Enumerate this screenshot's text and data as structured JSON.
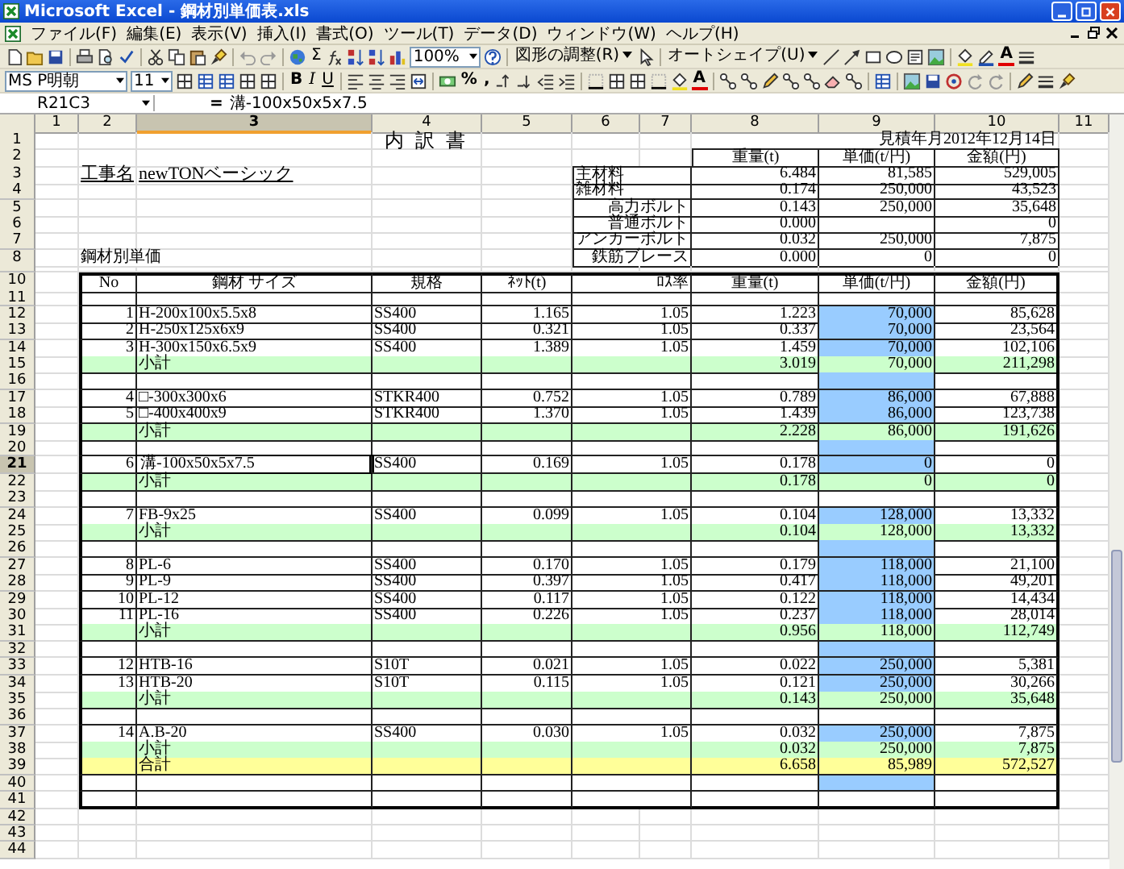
{
  "window": {
    "title": "Microsoft Excel - 鋼材別単価表.xls"
  },
  "menu": [
    "ファイル(F)",
    "編集(E)",
    "表示(V)",
    "挿入(I)",
    "書式(O)",
    "ツール(T)",
    "データ(D)",
    "ウィンドウ(W)",
    "ヘルプ(H)"
  ],
  "standard_toolbar": {
    "sum": "Σ",
    "zoom": "100%",
    "draw_menu": "図形の調整(R)",
    "autoshape_menu": "オートシェイプ(U)",
    "font_color": "A"
  },
  "format_toolbar": {
    "font": "MS P明朝",
    "size": "11",
    "bold": "B",
    "italic": "I",
    "underline": "U",
    "percent": "%",
    "comma": ",",
    "font_color": "A"
  },
  "formula_bar": {
    "name_box": "R21C3",
    "equals": "=",
    "formula": "溝-100x50x5x7.5"
  },
  "columns": [
    {
      "label": "1",
      "selected": false
    },
    {
      "label": "2",
      "selected": false
    },
    {
      "label": "3",
      "selected": true
    },
    {
      "label": "4",
      "selected": false
    },
    {
      "label": "5",
      "selected": false
    },
    {
      "label": "6",
      "selected": false
    },
    {
      "label": "7",
      "selected": false
    },
    {
      "label": "8",
      "selected": false
    },
    {
      "label": "9",
      "selected": false
    },
    {
      "label": "10",
      "selected": false
    },
    {
      "label": "11",
      "selected": false
    }
  ],
  "rows": [
    {
      "number": "1",
      "selected": false,
      "kind": "title",
      "title": "内 訳 書",
      "date": "見積年月2012年12月14日"
    },
    {
      "number": "2",
      "selected": false,
      "kind": "summary_head",
      "weight": "重量(t)",
      "unit_price": "単価(t/円)",
      "amount": "金額(円)"
    },
    {
      "number": "3",
      "selected": false,
      "kind": "main_summary",
      "project_label": "工事名",
      "project_name": "newTONベーシック",
      "label": "主材料",
      "weight": "6.484",
      "unit_price": "81,585",
      "amount": "529,005"
    },
    {
      "number": "4",
      "selected": false,
      "kind": "main_summary",
      "label": "雑材料",
      "weight": "0.174",
      "unit_price": "250,000",
      "amount": "43,523"
    },
    {
      "number": "5",
      "selected": false,
      "kind": "sub_summary",
      "label": "高力ボルト",
      "weight": "0.143",
      "unit_price": "250,000",
      "amount": "35,648"
    },
    {
      "number": "6",
      "selected": false,
      "kind": "sub_summary",
      "label": "普通ボルト",
      "weight": "0.000",
      "amount": "0"
    },
    {
      "number": "7",
      "selected": false,
      "kind": "sub_summary",
      "label": "アンカーボルト",
      "weight": "0.032",
      "unit_price": "250,000",
      "amount": "7,875"
    },
    {
      "number": "8",
      "selected": false,
      "kind": "sub_summary",
      "section_label": "鋼材別単価",
      "label": "鉄筋ブレース",
      "weight": "0.000",
      "unit_price": "0",
      "amount": "0"
    },
    {
      "kind": "collapsed"
    },
    {
      "number": "10",
      "selected": false,
      "kind": "table_head",
      "no": "No",
      "size": "鋼材 サイズ",
      "grade": "規格",
      "net": "ﾈｯﾄ(t)",
      "loss": "ﾛｽ率",
      "weight": "重量(t)",
      "unit_price": "単価(t/円)",
      "amount": "金額(円)"
    },
    {
      "number": "11",
      "selected": false,
      "kind": "table_blank",
      "highlighted": false
    },
    {
      "number": "12",
      "selected": false,
      "kind": "item",
      "no": "1",
      "size": "H-200x100x5.5x8",
      "grade": "SS400",
      "net": "1.165",
      "loss": "1.05",
      "weight": "1.223",
      "unit_price": "70,000",
      "amount": "85,628"
    },
    {
      "number": "13",
      "selected": false,
      "kind": "item",
      "no": "2",
      "size": "H-250x125x6x9",
      "grade": "SS400",
      "net": "0.321",
      "loss": "1.05",
      "weight": "0.337",
      "unit_price": "70,000",
      "amount": "23,564"
    },
    {
      "number": "14",
      "selected": false,
      "kind": "item",
      "no": "3",
      "size": "H-300x150x6.5x9",
      "grade": "SS400",
      "net": "1.389",
      "loss": "1.05",
      "weight": "1.459",
      "unit_price": "70,000",
      "amount": "102,106"
    },
    {
      "number": "15",
      "selected": false,
      "kind": "subtotal",
      "label": "小計",
      "weight": "3.019",
      "unit_price": "70,000",
      "amount": "211,298"
    },
    {
      "number": "16",
      "selected": false,
      "kind": "table_blank",
      "highlighted": true
    },
    {
      "number": "17",
      "selected": false,
      "kind": "item",
      "no": "4",
      "size": "□-300x300x6",
      "grade": "STKR400",
      "net": "0.752",
      "loss": "1.05",
      "weight": "0.789",
      "unit_price": "86,000",
      "amount": "67,888"
    },
    {
      "number": "18",
      "selected": false,
      "kind": "item",
      "no": "5",
      "size": "□-400x400x9",
      "grade": "STKR400",
      "net": "1.370",
      "loss": "1.05",
      "weight": "1.439",
      "unit_price": "86,000",
      "amount": "123,738"
    },
    {
      "number": "19",
      "selected": false,
      "kind": "subtotal",
      "label": "小計",
      "weight": "2.228",
      "unit_price": "86,000",
      "amount": "191,626"
    },
    {
      "number": "20",
      "selected": false,
      "kind": "table_blank",
      "highlighted": true
    },
    {
      "number": "21",
      "selected": true,
      "kind": "item",
      "no": "6",
      "size": "溝-100x50x5x7.5",
      "grade": "SS400",
      "net": "0.169",
      "loss": "1.05",
      "weight": "0.178",
      "unit_price": "0",
      "amount": "0"
    },
    {
      "number": "22",
      "selected": false,
      "kind": "subtotal",
      "label": "小計",
      "weight": "0.178",
      "unit_price": "0",
      "amount": "0"
    },
    {
      "number": "23",
      "selected": false,
      "kind": "table_blank",
      "highlighted": false
    },
    {
      "number": "24",
      "selected": false,
      "kind": "item",
      "no": "7",
      "size": "FB-9x25",
      "grade": "SS400",
      "net": "0.099",
      "loss": "1.05",
      "weight": "0.104",
      "unit_price": "128,000",
      "amount": "13,332"
    },
    {
      "number": "25",
      "selected": false,
      "kind": "subtotal",
      "label": "小計",
      "weight": "0.104",
      "unit_price": "128,000",
      "amount": "13,332"
    },
    {
      "number": "26",
      "selected": false,
      "kind": "table_blank",
      "highlighted": true
    },
    {
      "number": "27",
      "selected": false,
      "kind": "item",
      "no": "8",
      "size": "PL-6",
      "grade": "SS400",
      "net": "0.170",
      "loss": "1.05",
      "weight": "0.179",
      "unit_price": "118,000",
      "amount": "21,100"
    },
    {
      "number": "28",
      "selected": false,
      "kind": "item",
      "no": "9",
      "size": "PL-9",
      "grade": "SS400",
      "net": "0.397",
      "loss": "1.05",
      "weight": "0.417",
      "unit_price": "118,000",
      "amount": "49,201"
    },
    {
      "number": "29",
      "selected": false,
      "kind": "item",
      "no": "10",
      "size": "PL-12",
      "grade": "SS400",
      "net": "0.117",
      "loss": "1.05",
      "weight": "0.122",
      "unit_price": "118,000",
      "amount": "14,434"
    },
    {
      "number": "30",
      "selected": false,
      "kind": "item",
      "no": "11",
      "size": "PL-16",
      "grade": "SS400",
      "net": "0.226",
      "loss": "1.05",
      "weight": "0.237",
      "unit_price": "118,000",
      "amount": "28,014"
    },
    {
      "number": "31",
      "selected": false,
      "kind": "subtotal",
      "label": "小計",
      "weight": "0.956",
      "unit_price": "118,000",
      "amount": "112,749"
    },
    {
      "number": "32",
      "selected": false,
      "kind": "table_blank",
      "highlighted": true
    },
    {
      "number": "33",
      "selected": false,
      "kind": "item",
      "no": "12",
      "size": "HTB-16",
      "grade": "S10T",
      "net": "0.021",
      "loss": "1.05",
      "weight": "0.022",
      "unit_price": "250,000",
      "amount": "5,381"
    },
    {
      "number": "34",
      "selected": false,
      "kind": "item",
      "no": "13",
      "size": "HTB-20",
      "grade": "S10T",
      "net": "0.115",
      "loss": "1.05",
      "weight": "0.121",
      "unit_price": "250,000",
      "amount": "30,266"
    },
    {
      "number": "35",
      "selected": false,
      "kind": "subtotal",
      "label": "小計",
      "weight": "0.143",
      "unit_price": "250,000",
      "amount": "35,648"
    },
    {
      "number": "36",
      "selected": false,
      "kind": "table_blank",
      "highlighted": false
    },
    {
      "number": "37",
      "selected": false,
      "kind": "item",
      "no": "14",
      "size": "A.B-20",
      "grade": "SS400",
      "net": "0.030",
      "loss": "1.05",
      "weight": "0.032",
      "unit_price": "250,000",
      "amount": "7,875"
    },
    {
      "number": "38",
      "selected": false,
      "kind": "subtotal",
      "label": "小計",
      "weight": "0.032",
      "unit_price": "250,000",
      "amount": "7,875"
    },
    {
      "number": "39",
      "selected": false,
      "kind": "total",
      "label": "合計",
      "weight": "6.658",
      "unit_price": "85,989",
      "amount": "572,527"
    },
    {
      "number": "40",
      "selected": false,
      "kind": "table_blank",
      "highlighted": true
    },
    {
      "number": "41",
      "selected": false,
      "kind": "table_blank",
      "highlighted": false
    },
    {
      "number": "42",
      "selected": false,
      "kind": "blank"
    },
    {
      "number": "43",
      "selected": false,
      "kind": "blank"
    },
    {
      "number": "44",
      "selected": false,
      "kind": "blank"
    }
  ]
}
